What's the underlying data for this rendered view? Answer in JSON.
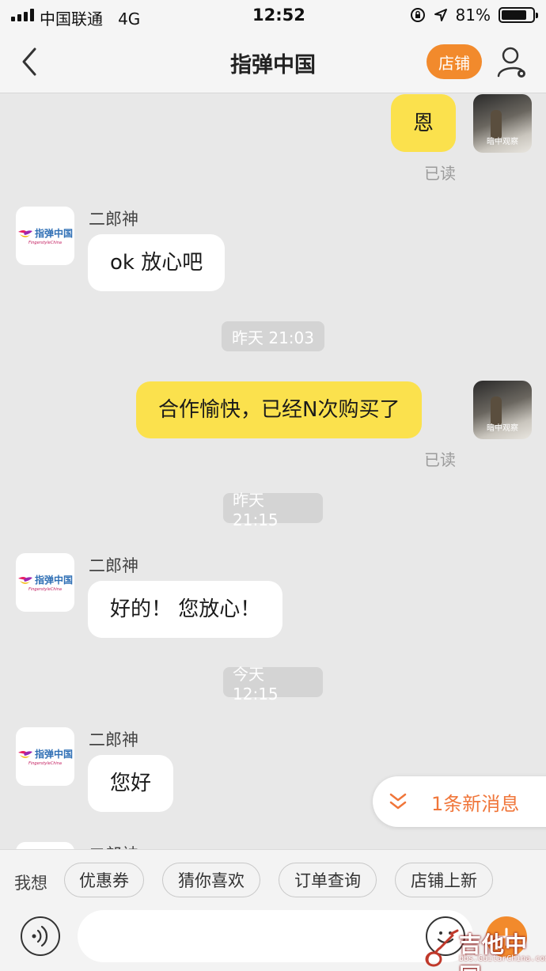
{
  "status_bar": {
    "carrier": "中国联通",
    "network": "4G",
    "time": "12:52",
    "battery": "81%",
    "battery_level": 0.81
  },
  "nav": {
    "title": "指弹中国",
    "store_button": "店铺"
  },
  "shop_avatar": {
    "logo_text": "指弹中国",
    "logo_sub": "FingerstyleChina"
  },
  "self_avatar": {
    "caption": "暗中观察"
  },
  "messages": [
    {
      "from": "me",
      "text": "恩",
      "status": "已读"
    },
    {
      "from": "shop",
      "sender": "二郎神",
      "text": "ok 放心吧"
    },
    {
      "type": "time",
      "text": "昨天 21:03"
    },
    {
      "from": "me",
      "text": "合作愉快，已经N次购买了",
      "status": "已读"
    },
    {
      "type": "time",
      "text": "昨天 21:15"
    },
    {
      "from": "shop",
      "sender": "二郎神",
      "text": "好的！ 您放心！"
    },
    {
      "type": "time",
      "text": "今天 12:15"
    },
    {
      "from": "shop",
      "sender": "二郎神",
      "text": "您好"
    },
    {
      "from": "shop",
      "sender": "二郎神",
      "text": ""
    }
  ],
  "new_message_banner": "1条新消息",
  "quick_bar": {
    "label": "我想",
    "chips": [
      "优惠券",
      "猜你喜欢",
      "订单查询",
      "店铺上新"
    ]
  },
  "input": {
    "placeholder": ""
  },
  "watermark": {
    "main": "吉他中国",
    "sub": "bbs.GuitarChina.com"
  },
  "colors": {
    "accent": "#f28a2c",
    "my_bubble": "#fbe14d",
    "their_bubble": "#ffffff",
    "chat_bg": "#e8e8e8",
    "banner_text": "#f0763a"
  }
}
